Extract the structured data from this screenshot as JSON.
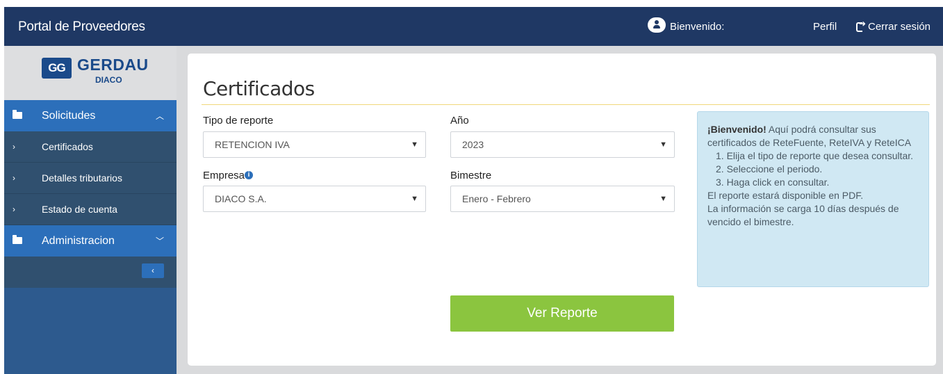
{
  "header": {
    "brand": "Portal de Proveedores",
    "welcome": "Bienvenido:",
    "profile": "Perfil",
    "logout": "Cerrar sesión"
  },
  "sidebar": {
    "logo_mark": "GG",
    "logo_name": "GERDAU",
    "logo_sub": "DIACO",
    "items": [
      {
        "label": "Solicitudes",
        "icon": "folder-open-icon",
        "chevron": "chevron-up-icon"
      },
      {
        "label": "Certificados",
        "icon": "chevron-right-icon"
      },
      {
        "label": "Detalles tributarios",
        "icon": "chevron-right-icon"
      },
      {
        "label": "Estado de cuenta",
        "icon": "chevron-right-icon"
      },
      {
        "label": "Administracion",
        "icon": "folder-open-icon",
        "chevron": "chevron-down-icon"
      }
    ],
    "collapse_icon": "chevron-left-icon"
  },
  "main": {
    "title": "Certificados",
    "fields": {
      "tipo_label": "Tipo de reporte",
      "tipo_value": "RETENCION IVA",
      "anio_label": "Año",
      "anio_value": "2023",
      "empresa_label": "Empresa",
      "empresa_value": "DIACO S.A.",
      "bimestre_label": "Bimestre",
      "bimestre_value": "Enero - Febrero"
    },
    "info": {
      "lead": "¡Bienvenido!",
      "text1": " Aquí podrá consultar sus certificados de ReteFuente, ReteIVA y ReteICA",
      "step1": "1. Elija el tipo de reporte que desea consultar.",
      "step2": "2. Seleccione el periodo.",
      "step3": "3. Haga click en consultar.",
      "line1": "El reporte estará disponible en PDF.",
      "line2": "La información se carga 10 días después de vencido el bimestre."
    },
    "button": "Ver Reporte"
  },
  "colors": {
    "navbar": "#1f3864",
    "sidebar": "#2d5a8e",
    "accent_blue": "#2c6fba",
    "button_green": "#8bc53f",
    "info_bg": "#d0e8f3"
  }
}
